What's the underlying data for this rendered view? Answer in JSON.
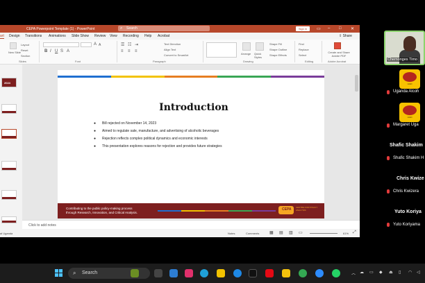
{
  "powerpoint": {
    "title": "CEPA Powerpoint Template (1)  -  PowerPoint",
    "search_placeholder": "Search",
    "sign_in": "Sign in",
    "share": "Share",
    "tabs": [
      "art",
      "Design",
      "Transitions",
      "Animations",
      "Slide Show",
      "Review",
      "View",
      "Recording",
      "Help",
      "Acrobat"
    ],
    "selected_tab": 0,
    "ribbon": {
      "new_slide": "New Slide",
      "layout": "Layout",
      "reset": "Reset",
      "section": "Section",
      "group_slides": "Slides",
      "group_font": "Font",
      "group_paragraph": "Paragraph",
      "group_drawing": "Drawing",
      "group_editing": "Editing",
      "group_acrobat": "Adobe Acrobat",
      "text_direction": "Text Direction",
      "align_text": "Align Text",
      "convert_smartart": "Convert to SmartArt",
      "arrange": "Arrange",
      "quick_styles": "Quick Styles",
      "shape_fill": "Shape Fill",
      "shape_outline": "Shape Outline",
      "shape_effects": "Shape Effects",
      "find": "Find",
      "replace": "Replace",
      "select": "Select",
      "create_share": "Create and Share Adobe PDF"
    },
    "thumbnail_first_label": "2024",
    "notes_placeholder": "Click to add notes",
    "status": {
      "left": "al  Uganda",
      "notes": "Notes",
      "comments": "Comments",
      "zoom": "61%"
    }
  },
  "slide": {
    "title": "Introduction",
    "bullets": [
      "Bill rejected on November 14, 2023",
      "Aimed to regulate sale, manufacture, and advertising of alcoholic beverages",
      "Rejection reflects complex political dynamics and economic interests",
      "This presentation explores reasons for rejection and provides future strategies"
    ],
    "footer_line1": "Contributing to the public policy-making process",
    "footer_line2": "through Research, Innovation, and Critical Analysis.",
    "logo_mark": "CEPA",
    "logo_text": "CENTRE FOR POLICY ANALYSIS",
    "stripe_colors": [
      "#1f6fd0",
      "#f2c200",
      "#e67e22",
      "#3aa655",
      "#7a3c9a"
    ]
  },
  "participants": {
    "video_label": "Chemonges Timo",
    "list": [
      {
        "name": "Uganda Alcoh",
        "avatar_text": "UAFI"
      },
      {
        "name": "Margaret Uga",
        "avatar_text": "UAFI"
      },
      {
        "display": "Shafic Shakim",
        "name": "Shafic Shakim H"
      },
      {
        "display": "Chris Kwize",
        "name": "Chris Kwizera"
      },
      {
        "display": "Yuto Koriya",
        "name": "Yuto Koriyama"
      }
    ]
  },
  "taskbar": {
    "search_label": "Search"
  }
}
